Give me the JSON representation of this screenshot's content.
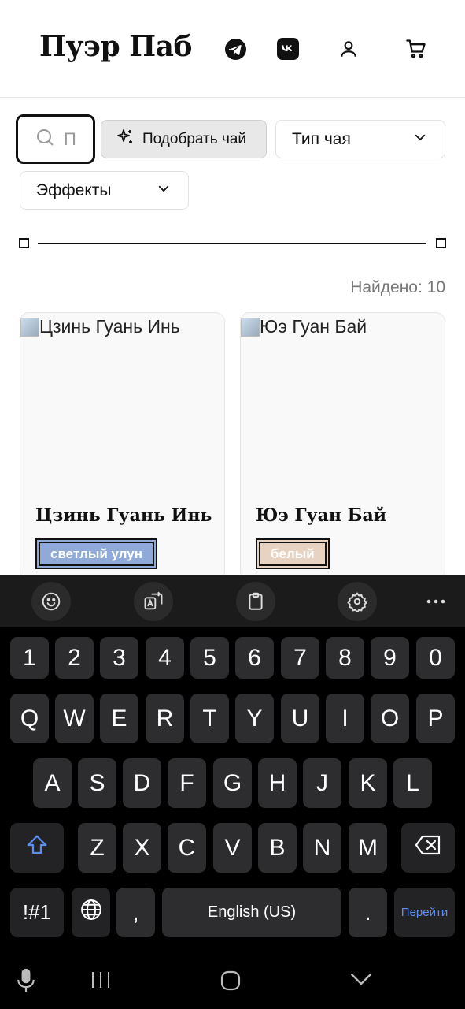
{
  "header": {
    "logo": "Пуэр Паб",
    "icons": [
      "telegram-icon",
      "vk-icon",
      "user-icon",
      "cart-icon"
    ]
  },
  "filters": {
    "search_value": "П",
    "pick_tea_label": "Подобрать чай",
    "tea_type_label": "Тип чая",
    "effects_label": "Эффекты"
  },
  "results": {
    "found_text": "Найдено: 10"
  },
  "products": [
    {
      "image_alt": "Цзинь Гуань Инь",
      "name": "Цзинь Гуань Инь",
      "tag": "светлый улун",
      "tag_color": "#8fa9d8"
    },
    {
      "image_alt": "Юэ Гуан Бай",
      "name": "Юэ Гуан Бай",
      "tag": "белый",
      "tag_color": "#e8d3c2"
    }
  ],
  "keyboard": {
    "toolbar": [
      "emoji-icon",
      "translate-icon",
      "clipboard-icon",
      "settings-icon",
      "more-icon"
    ],
    "row_numbers": [
      "1",
      "2",
      "3",
      "4",
      "5",
      "6",
      "7",
      "8",
      "9",
      "0"
    ],
    "row_top": [
      "Q",
      "W",
      "E",
      "R",
      "T",
      "Y",
      "U",
      "I",
      "O",
      "P"
    ],
    "row_mid": [
      "A",
      "S",
      "D",
      "F",
      "G",
      "H",
      "J",
      "K",
      "L"
    ],
    "row_bottom": [
      "Z",
      "X",
      "C",
      "V",
      "B",
      "N",
      "M"
    ],
    "symbols_label": "!#1",
    "comma": ",",
    "space_label": "English (US)",
    "period": ".",
    "go_label": "Перейти"
  },
  "navbar": {
    "icons": [
      "microphone-icon",
      "recent-apps-icon",
      "home-icon",
      "back-chevron-icon"
    ]
  }
}
